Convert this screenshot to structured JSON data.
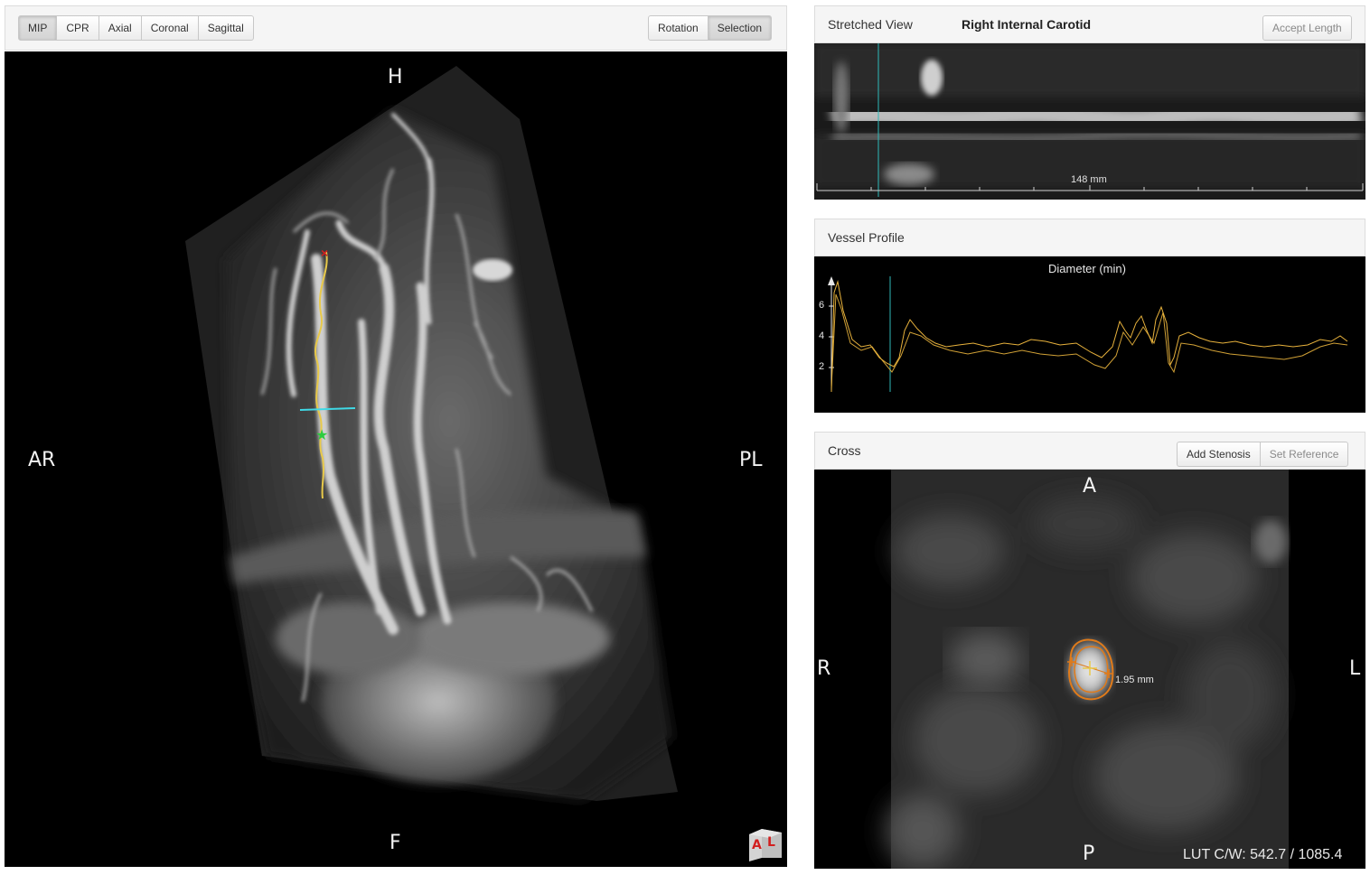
{
  "left": {
    "view_buttons": [
      "MIP",
      "CPR",
      "Axial",
      "Coronal",
      "Sagittal"
    ],
    "active_view": "MIP",
    "mode_buttons": [
      "Rotation",
      "Selection"
    ],
    "active_mode": "Selection",
    "orientation": {
      "top": "H",
      "bottom": "F",
      "left": "AR",
      "right": "PL"
    },
    "cube_labels": [
      "A",
      "L"
    ]
  },
  "stretched": {
    "title": "Stretched View",
    "vessel": "Right Internal Carotid",
    "accept_button": "Accept Length",
    "scale_label": "148 mm"
  },
  "profile": {
    "title": "Vessel Profile",
    "chart_title": "Diameter (min)",
    "y_ticks": [
      "6",
      "4",
      "2"
    ],
    "line_color": "#e8b23c",
    "cursor_color": "#2fb9b9"
  },
  "cross": {
    "title": "Cross",
    "add_stenosis": "Add Stenosis",
    "set_reference": "Set Reference",
    "orientation": {
      "top": "A",
      "bottom": "P",
      "left": "R",
      "right": "L"
    },
    "measurement": "1.95 mm",
    "lut": "LUT C/W: 542.7 / 1085.4",
    "contour_color": "#e07b1a"
  }
}
